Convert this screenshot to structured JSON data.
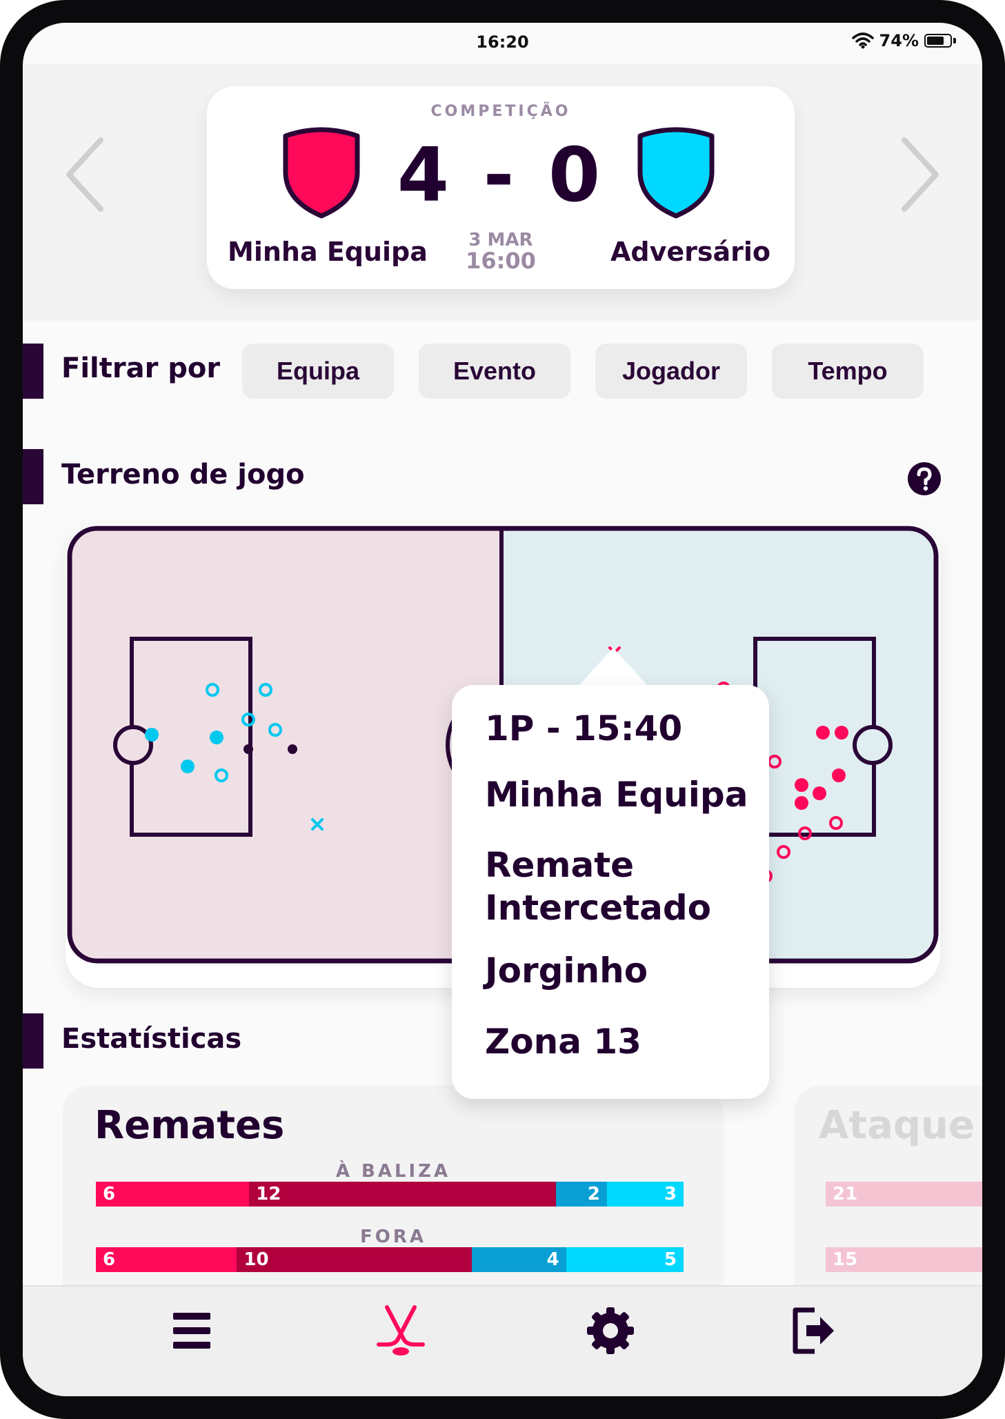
{
  "status": {
    "time": "16:20",
    "battery": "74%",
    "battery_level": 0.74
  },
  "match": {
    "competition": "COMPETIÇÃO",
    "score": "4 - 0",
    "home_team": "Minha Equipa",
    "away_team": "Adversário",
    "date": "3 MAR",
    "time": "16:00",
    "home_color": "#ff0a5a",
    "away_color": "#00d8ff"
  },
  "filters": {
    "title": "Filtrar por",
    "buttons": [
      "Equipa",
      "Evento",
      "Jogador",
      "Tempo"
    ]
  },
  "pitch": {
    "title": "Terreno de jogo",
    "help_icon": "question-circle-icon",
    "home_bg": "#efe0e6",
    "away_bg": "#e0eef2",
    "line_color": "#2a0637"
  },
  "tooltip": {
    "period_time": "1P - 15:40",
    "team": "Minha Equipa",
    "event_line1": "Remate",
    "event_line2": "Intercetado",
    "player": "Jorginho",
    "zone": "Zona 13"
  },
  "stats": {
    "title": "Estatísticas",
    "cards": [
      {
        "title": "Remates",
        "rows": [
          {
            "label": "À BALIZA",
            "segments": [
              6,
              12,
              2,
              3
            ]
          },
          {
            "label": "FORA",
            "segments": [
              6,
              10,
              4,
              5
            ]
          }
        ]
      },
      {
        "title": "Ataque",
        "rows": [
          {
            "label": "",
            "segments": [
              21
            ]
          },
          {
            "label": "",
            "segments": [
              15
            ]
          }
        ]
      }
    ],
    "segment_colors": [
      "#ff0a5a",
      "#b1003d",
      "#0a9fd4",
      "#00d8ff"
    ]
  },
  "tabbar": {
    "items": [
      "menu-icon",
      "hockey-sticks-icon",
      "gear-icon",
      "logout-icon"
    ],
    "active_color": "#ff0a5a"
  }
}
